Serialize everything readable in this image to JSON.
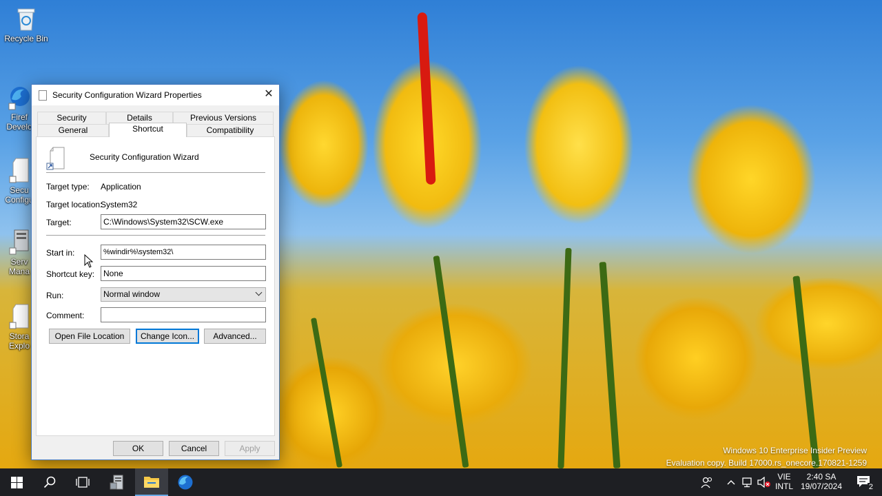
{
  "desktop": {
    "icons": [
      {
        "label": "Recycle Bin"
      },
      {
        "label": "Firef\nDevelo"
      },
      {
        "label": "Secu\nConfigu"
      },
      {
        "label": "Serv\nMana"
      },
      {
        "label": "Stora\nExplo"
      }
    ]
  },
  "dialog": {
    "title": "Security Configuration Wizard Properties",
    "close_glyph": "✕",
    "tabs_row1": [
      "Security",
      "Details",
      "Previous Versions"
    ],
    "tabs_row2": [
      "General",
      "Shortcut",
      "Compatibility"
    ],
    "active_tab": "Shortcut",
    "shortcut_name": "Security Configuration Wizard",
    "target_type_label": "Target type:",
    "target_type_value": "Application",
    "target_location_label": "Target location:",
    "target_location_value": "System32",
    "target_label": "Target:",
    "target_value": "C:\\Windows\\System32\\SCW.exe",
    "start_in_label": "Start in:",
    "start_in_value": "%windir%\\system32\\",
    "shortcut_key_label": "Shortcut key:",
    "shortcut_key_value": "None",
    "run_label": "Run:",
    "run_value": "Normal window",
    "comment_label": "Comment:",
    "comment_value": "",
    "buttons": {
      "open_file_location": "Open File Location",
      "change_icon": "Change Icon...",
      "advanced": "Advanced...",
      "ok": "OK",
      "cancel": "Cancel",
      "apply": "Apply"
    }
  },
  "watermark": {
    "line1": "Windows 10 Enterprise Insider Preview",
    "line2": "Evaluation copy. Build 17000.rs_onecore.170821-1259"
  },
  "taskbar": {
    "lang_line1": "VIE",
    "lang_line2": "INTL",
    "time": "2:40 SA",
    "date": "19/07/2024",
    "notification_count": "2"
  },
  "colors": {
    "accent": "#0078d7",
    "taskbar": "#1e1f23",
    "dialog_border": "#4a7cc0"
  }
}
